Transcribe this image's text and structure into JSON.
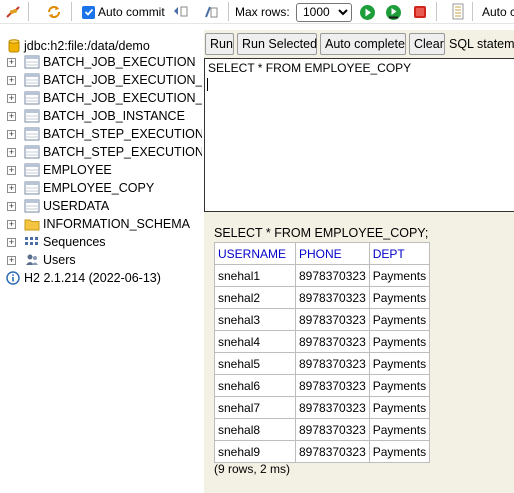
{
  "toolbar": {
    "auto_commit_label": "Auto commit",
    "max_rows_label": "Max rows:",
    "max_rows_value": "1000",
    "auto_cut_label": "Auto c"
  },
  "tree": {
    "connection": "jdbc:h2:file:/data/demo",
    "tables": [
      "BATCH_JOB_EXECUTION",
      "BATCH_JOB_EXECUTION_C",
      "BATCH_JOB_EXECUTION_P",
      "BATCH_JOB_INSTANCE",
      "BATCH_STEP_EXECUTION",
      "BATCH_STEP_EXECUTION_",
      "EMPLOYEE",
      "EMPLOYEE_COPY",
      "USERDATA"
    ],
    "schema": "INFORMATION_SCHEMA",
    "sequences": "Sequences",
    "users": "Users",
    "version": "H2 2.1.214 (2022-06-13)"
  },
  "buttons": {
    "run": "Run",
    "run_selected": "Run Selected",
    "auto_complete": "Auto complete",
    "clear": "Clear",
    "sql_statement_label": "SQL stateme"
  },
  "editor": {
    "text": "SELECT * FROM EMPLOYEE_COPY"
  },
  "result": {
    "query": "SELECT * FROM EMPLOYEE_COPY;",
    "columns": [
      "USERNAME",
      "PHONE",
      "DEPT"
    ],
    "rows": [
      [
        "snehal1",
        "8978370323",
        "Payments"
      ],
      [
        "snehal2",
        "8978370323",
        "Payments"
      ],
      [
        "snehal3",
        "8978370323",
        "Payments"
      ],
      [
        "snehal4",
        "8978370323",
        "Payments"
      ],
      [
        "snehal5",
        "8978370323",
        "Payments"
      ],
      [
        "snehal6",
        "8978370323",
        "Payments"
      ],
      [
        "snehal7",
        "8978370323",
        "Payments"
      ],
      [
        "snehal8",
        "8978370323",
        "Payments"
      ],
      [
        "snehal9",
        "8978370323",
        "Payments"
      ]
    ],
    "status": "(9 rows, 2 ms)"
  },
  "icons": {
    "disconnect": "disconnect-icon",
    "refresh": "refresh-icon",
    "rollback": "rollback-icon",
    "commit": "commit-icon",
    "run": "run-icon",
    "run-selected": "debug-run-icon",
    "stop": "stop-icon",
    "history": "history-icon"
  },
  "colors": {
    "panel_bg": "#f3f0e4",
    "header_text": "#0000c8",
    "run_green": "#1e9e3a",
    "stop_red": "#d0261c",
    "checkbox_blue": "#1a73e8"
  }
}
